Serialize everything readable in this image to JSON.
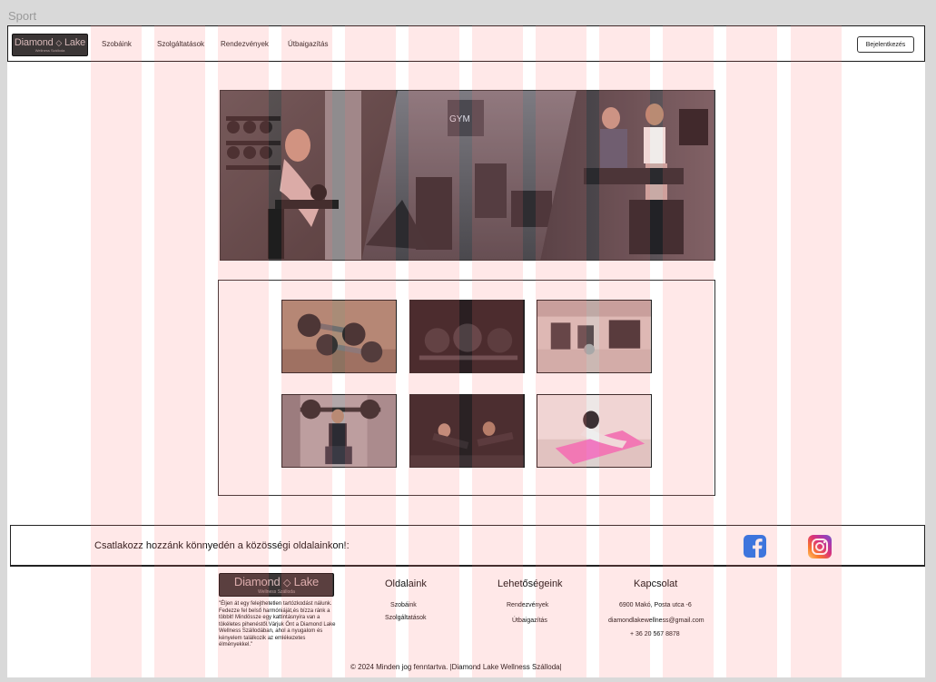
{
  "frame": {
    "title": "Sport"
  },
  "brand": {
    "name_left": "Diamond",
    "name_right": "Lake",
    "subtitle": "Wellness Szálloda"
  },
  "nav": {
    "items": [
      "Szobáink",
      "Szolgáltatások",
      "Rendezvények",
      "Útbaigazítás"
    ],
    "login_label": "Bejelentkezés"
  },
  "social": {
    "text": "Csatlakozz hozzánk könnyedén a közösségi oldalainkon!:",
    "icons": [
      "facebook-icon",
      "instagram-icon"
    ]
  },
  "footer": {
    "description": "\"Éljen át egy felejthetetlen tartózkodást nálunk. Fedezze fel belső harmóniáját,és bízza ránk a többit! Mindössze egy kattintásnyira van a tökéletes pihenéstől.Várjuk Önt a Diamond Lake Wellness Szállodában, ahol a nyugalom és kényelem találkozik az emlékezetes élményekkel.\"",
    "columns": [
      {
        "heading": "Oldalaink",
        "items": [
          "Szobáink",
          "Szolgáltatások"
        ]
      },
      {
        "heading": "Lehetőségeink",
        "items": [
          "Rendezvények",
          "Útbaigazítás"
        ]
      },
      {
        "heading": "Kapcsolat",
        "items": [
          "6900 Makó, Posta  utca -6",
          "diamondlakewellness@gmail.com",
          "+ 36 20 567 8878"
        ]
      }
    ],
    "copyright": "© 2024 Minden jog fenntartva. |Diamond Lake Wellness Szálloda|"
  },
  "colors": {
    "grid_overlay": "#ff6e6e",
    "logo_bg": "#3b3636",
    "logo_text": "#d6b8b8",
    "facebook": "#1877f2"
  }
}
